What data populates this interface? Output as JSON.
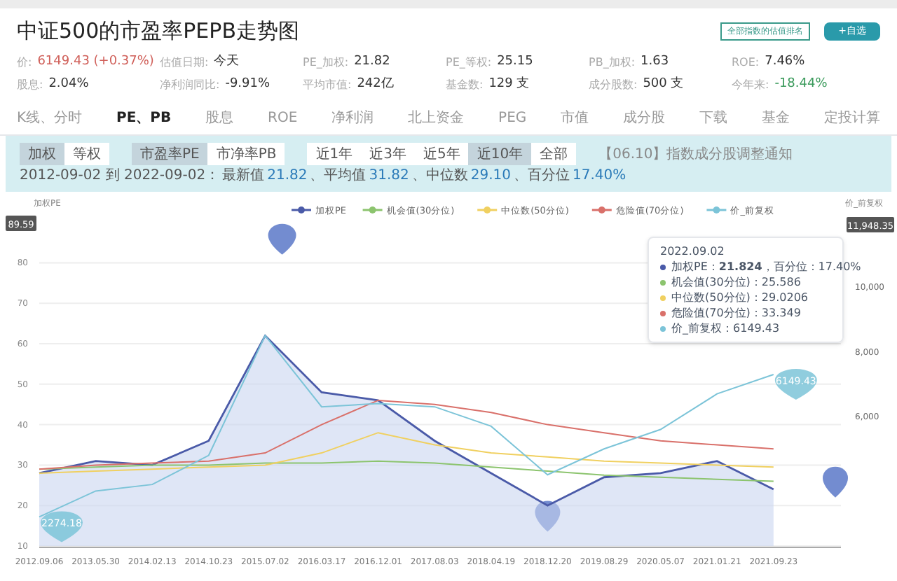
{
  "header": {
    "title": "中证500的市盈率PEPB走势图",
    "buttons": [
      {
        "kind": "outline",
        "label": "全部指数的估值排名"
      },
      {
        "kind": "solid",
        "label": "+自选"
      }
    ]
  },
  "stats": [
    {
      "label": "价:",
      "value": "6149.43 (+0.37%)",
      "color": "#d0605a"
    },
    {
      "label": "估值日期:",
      "value": "今天",
      "color": "#333333"
    },
    {
      "label": "PE_加权:",
      "value": "21.82",
      "color": "#333333"
    },
    {
      "label": "PE_等权:",
      "value": "25.15",
      "color": "#333333"
    },
    {
      "label": "PB_加权:",
      "value": "1.63",
      "color": "#333333"
    },
    {
      "label": "ROE:",
      "value": "7.46%",
      "color": "#333333"
    },
    {
      "label": "股息:",
      "value": "2.04%",
      "color": "#333333"
    },
    {
      "label": "净利润同比:",
      "value": "-9.91%",
      "color": "#333333"
    },
    {
      "label": "平均市值:",
      "value": "242亿",
      "color": "#333333"
    },
    {
      "label": "基金数:",
      "value": "129 支",
      "color": "#333333"
    },
    {
      "label": "成分股数:",
      "value": "500 支",
      "color": "#333333"
    },
    {
      "label": "今年来:",
      "value": "-18.44%",
      "color": "#3a9a5b"
    }
  ],
  "nav": [
    {
      "label": "K线、分时",
      "selected": false
    },
    {
      "label": "PE、PB",
      "selected": true
    },
    {
      "label": "股息",
      "selected": false
    },
    {
      "label": "ROE",
      "selected": false
    },
    {
      "label": "净利润",
      "selected": false
    },
    {
      "label": "北上资金",
      "selected": false
    },
    {
      "label": "PEG",
      "selected": false
    },
    {
      "label": "市值",
      "selected": false
    },
    {
      "label": "成分股",
      "selected": false
    },
    {
      "label": "下载",
      "selected": false
    },
    {
      "label": "基金",
      "selected": false
    },
    {
      "label": "定投计算",
      "selected": false
    }
  ],
  "toggle_groups": [
    [
      {
        "label": "加权",
        "selected": true
      },
      {
        "label": "等权",
        "selected": false
      }
    ],
    [
      {
        "label": "市盈率PE",
        "selected": true
      },
      {
        "label": "市净率PB",
        "selected": false
      }
    ],
    [
      {
        "label": "近1年",
        "selected": false
      },
      {
        "label": "近3年",
        "selected": false
      },
      {
        "label": "近5年",
        "selected": false
      },
      {
        "label": "近10年",
        "selected": true
      },
      {
        "label": "全部",
        "selected": false
      }
    ]
  ],
  "notice": "【06.10】指数成分股调整通知",
  "summary": {
    "range": "2012-09-02 到 2022-09-02：",
    "stats": [
      {
        "label": "最新值",
        "value": "21.82"
      },
      {
        "label": "、平均值",
        "value": "31.82"
      },
      {
        "label": "、中位数",
        "value": "29.10"
      },
      {
        "label": "、百分位",
        "value": "17.40%"
      }
    ]
  },
  "chart": {
    "chart_data": {
      "type": "line",
      "ylabel": "加权PE",
      "y2label": "价_前复权",
      "categories": [
        "2012.09.06",
        "2013.05.30",
        "2014.02.13",
        "2014.10.23",
        "2015.07.02",
        "2016.03.17",
        "2016.12.01",
        "2017.08.03",
        "2018.04.19",
        "2018.12.20",
        "2019.08.29",
        "2020.05.07",
        "2021.01.21",
        "2021.09.23"
      ],
      "series": [
        {
          "name": "加权PE",
          "color": "#4a5aa8",
          "values": [
            28,
            31,
            30,
            36,
            62,
            48,
            46,
            36,
            28,
            20,
            27,
            28,
            31,
            24
          ]
        },
        {
          "name": "机会值(30分位)",
          "color": "#8cc46e",
          "values": [
            29,
            29.5,
            30,
            30,
            30.5,
            30.5,
            31,
            30.5,
            29.5,
            28.5,
            27.5,
            27,
            26.5,
            26
          ]
        },
        {
          "name": "中位数(50分位)",
          "color": "#f0d060",
          "values": [
            28,
            28.5,
            29,
            29.5,
            30,
            33,
            38,
            35,
            33,
            32,
            31,
            30.5,
            30,
            29.5
          ]
        },
        {
          "name": "危险值(70分位)",
          "color": "#d9706a",
          "values": [
            29,
            30,
            30.5,
            31,
            33,
            40,
            46,
            45,
            43,
            40,
            38,
            36,
            35,
            34
          ]
        },
        {
          "name": "价_前复权",
          "color": "#7cc4d8",
          "axis": "y2",
          "values": [
            2900,
            3700,
            3900,
            4800,
            8500,
            6300,
            6400,
            6300,
            5700,
            4200,
            5000,
            5600,
            6700,
            7300
          ]
        }
      ],
      "ylim": [
        10,
        89.59
      ],
      "y2lim": [
        2000,
        11948.35
      ],
      "yticks": [
        10,
        20,
        30,
        40,
        50,
        60,
        70,
        80,
        {
          "value": 89.59,
          "label": "89.59"
        }
      ],
      "y2ticks": [
        {
          "value": 6000,
          "label": "6,000"
        },
        {
          "value": 8000,
          "label": "8,000"
        },
        {
          "value": 10000,
          "label": "10,000"
        },
        {
          "value": 11948.35,
          "label": "11,948.35"
        }
      ],
      "grid": true,
      "legend": "top",
      "annotations": [
        "2274.18",
        "6149.43"
      ]
    },
    "tooltip": {
      "date": "2022.09.02",
      "rows": [
        {
          "text": "加权PE：**21.824**，百分位：17.40%",
          "color": "#4a5aa8"
        },
        {
          "text": "机会值(30分位)：25.586",
          "color": "#8cc46e"
        },
        {
          "text": "中位数(50分位)：29.0206",
          "color": "#f0d060"
        },
        {
          "text": "危险值(70分位)：33.349",
          "color": "#d9706a"
        },
        {
          "text": "价_前复权：6149.43",
          "color": "#7cc4d8"
        }
      ]
    }
  }
}
